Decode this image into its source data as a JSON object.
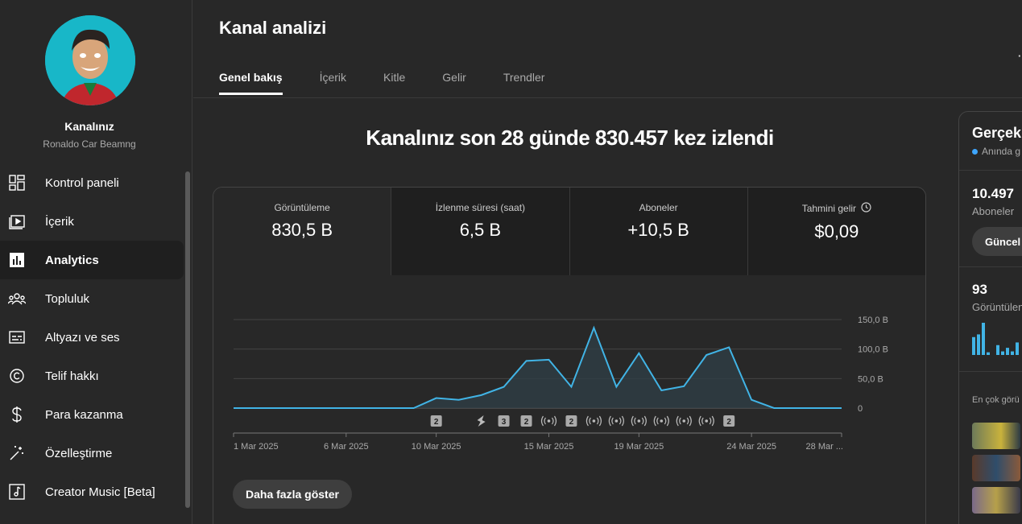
{
  "sidebar": {
    "channel_name": "Kanalınız",
    "channel_handle": "Ronaldo Car Beamng",
    "items": [
      {
        "label": "Kontrol paneli",
        "icon": "dashboard-icon"
      },
      {
        "label": "İçerik",
        "icon": "content-icon"
      },
      {
        "label": "Analytics",
        "icon": "analytics-icon",
        "active": true
      },
      {
        "label": "Topluluk",
        "icon": "community-icon"
      },
      {
        "label": "Altyazı ve ses",
        "icon": "subtitles-icon"
      },
      {
        "label": "Telif hakkı",
        "icon": "copyright-icon"
      },
      {
        "label": "Para kazanma",
        "icon": "dollar-icon"
      },
      {
        "label": "Özelleştirme",
        "icon": "magic-wand-icon"
      },
      {
        "label": "Creator Music [Beta]",
        "icon": "music-note-icon"
      }
    ]
  },
  "header": {
    "title": "Kanal analizi",
    "tabs": [
      "Genel bakış",
      "İçerik",
      "Kitle",
      "Gelir",
      "Trendler"
    ]
  },
  "headline": "Kanalınız son 28 günde 830.457 kez izlendi",
  "metrics": [
    {
      "label": "Görüntüleme",
      "value": "830,5 B"
    },
    {
      "label": "İzlenme süresi (saat)",
      "value": "6,5 B"
    },
    {
      "label": "Aboneler",
      "value": "+10,5 B"
    },
    {
      "label": "Tahmini gelir",
      "value": "$0,09"
    }
  ],
  "chart_data": {
    "type": "area",
    "series": [
      {
        "values": [
          0,
          0,
          0,
          0,
          0,
          0,
          0,
          0,
          0,
          17,
          14,
          22,
          36,
          80,
          82,
          36,
          136,
          36,
          93,
          30,
          37,
          90,
          103,
          14,
          0,
          0,
          0,
          0
        ]
      }
    ],
    "x_tick_labels": [
      "1 Mar 2025",
      "6 Mar 2025",
      "10 Mar 2025",
      "15 Mar 2025",
      "19 Mar 2025",
      "24 Mar 2025",
      "28 Mar ..."
    ],
    "x_tick_index": [
      0,
      5,
      9,
      14,
      18,
      23,
      27
    ],
    "y_tick_labels": [
      "150,0 B",
      "100,0 B",
      "50,0 B",
      "0"
    ],
    "y_ticks": [
      150,
      100,
      50,
      0
    ],
    "ylim": [
      0,
      150
    ],
    "grid": true,
    "line_color": "#41b4e6",
    "markers": [
      {
        "day": 9,
        "kind": "count",
        "label": "2"
      },
      {
        "day": 11,
        "kind": "shorts"
      },
      {
        "day": 12,
        "kind": "count",
        "label": "3"
      },
      {
        "day": 13,
        "kind": "count",
        "label": "2"
      },
      {
        "day": 14,
        "kind": "live"
      },
      {
        "day": 15,
        "kind": "count",
        "label": "2"
      },
      {
        "day": 16,
        "kind": "live"
      },
      {
        "day": 17,
        "kind": "live"
      },
      {
        "day": 18,
        "kind": "live"
      },
      {
        "day": 19,
        "kind": "live"
      },
      {
        "day": 20,
        "kind": "live"
      },
      {
        "day": 21,
        "kind": "live"
      },
      {
        "day": 22,
        "kind": "count",
        "label": "2"
      }
    ]
  },
  "show_more_label": "Daha fazla göster",
  "right_panel": {
    "title": "Gerçek",
    "live_label": "Anında g",
    "subscribers": "10.497",
    "subscribers_label": "Aboneler",
    "button_label": "Güncel",
    "views": "93",
    "views_label": "Görüntülen",
    "top_label": "En çok görü",
    "bar_values": [
      20,
      23,
      36,
      3,
      0,
      11,
      4,
      8,
      4,
      14
    ]
  },
  "colors": {
    "accent": "#3ea6ff",
    "line": "#41b4e6",
    "background": "#282828"
  }
}
